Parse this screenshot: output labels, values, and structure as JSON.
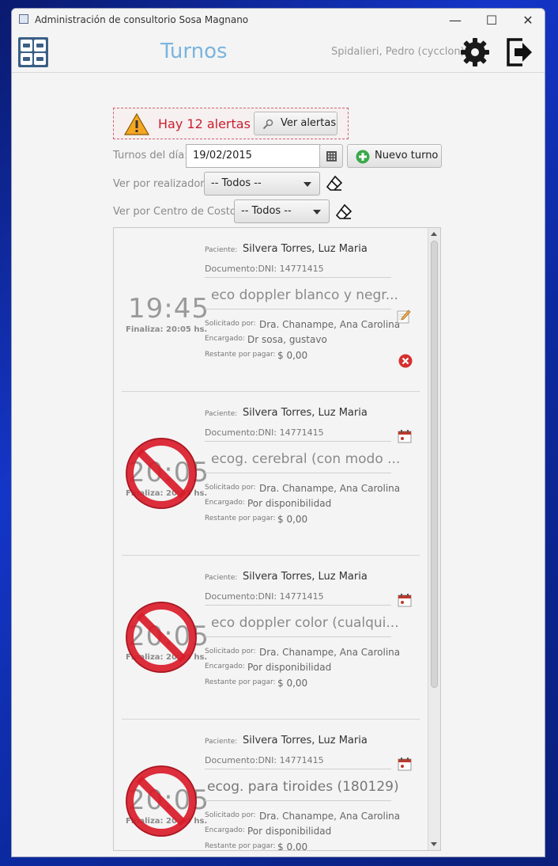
{
  "window": {
    "title": "Administración de consultorio Sosa Magnano",
    "controls": {
      "minimize": "—",
      "maximize": "☐",
      "close": "✕"
    }
  },
  "header": {
    "title": "Turnos",
    "user": "Spidalieri, Pedro (cycclon)"
  },
  "alert": {
    "text": "Hay 12 alertas",
    "button": "Ver alertas"
  },
  "filters": {
    "date_label": "Turnos del día:",
    "date_value": "19/02/2015",
    "new_button": "Nuevo turno",
    "realizador_label": "Ver por realizador:",
    "realizador_value": "-- Todos --",
    "centro_label": "Ver por Centro de Costo:",
    "centro_value": "-- Todos --"
  },
  "field_labels": {
    "paciente": "Paciente:",
    "documento": "Documento:",
    "solicitado": "Solicitado por:",
    "encargado": "Encargado:",
    "restante": "Restante por pagar:"
  },
  "appointments": [
    {
      "time": "19:45",
      "finaliza": "Finaliza: 20:05 hs.",
      "paciente": "Silvera Torres, Luz Maria",
      "documento": "DNI: 14771415",
      "estudio": "eco doppler blanco y negr...",
      "solicitado": "Dra. Chanampe, Ana Carolina",
      "encargado": "Dr sosa, gustavo",
      "restante": "$ 0,00",
      "cancelled": false
    },
    {
      "time": "20:05",
      "finaliza": "Finaliza: 20:25 hs.",
      "paciente": "Silvera Torres, Luz Maria",
      "documento": "DNI: 14771415",
      "estudio": "ecog. cerebral (con modo ...",
      "solicitado": "Dra. Chanampe, Ana Carolina",
      "encargado": "Por disponibilidad",
      "restante": "$ 0,00",
      "cancelled": true
    },
    {
      "time": "20:05",
      "finaliza": "Finaliza: 20:25 hs.",
      "paciente": "Silvera Torres, Luz Maria",
      "documento": "DNI: 14771415",
      "estudio": "eco doppler color (cualqui...",
      "solicitado": "Dra. Chanampe, Ana Carolina",
      "encargado": "Por disponibilidad",
      "restante": "$ 0,00",
      "cancelled": true
    },
    {
      "time": "20:05",
      "finaliza": "Finaliza: 20:25 hs.",
      "paciente": "Silvera Torres, Luz Maria",
      "documento": "DNI: 14771415",
      "estudio": "ecog. para tiroides (180129)",
      "solicitado": "Dra. Chanampe, Ana Carolina",
      "encargado": "Por disponibilidad",
      "restante": "$ 0,00",
      "cancelled": true
    }
  ],
  "colors": {
    "accent": "#7ab4df",
    "alert": "#c8202e",
    "cancel": "#d91c2a"
  }
}
